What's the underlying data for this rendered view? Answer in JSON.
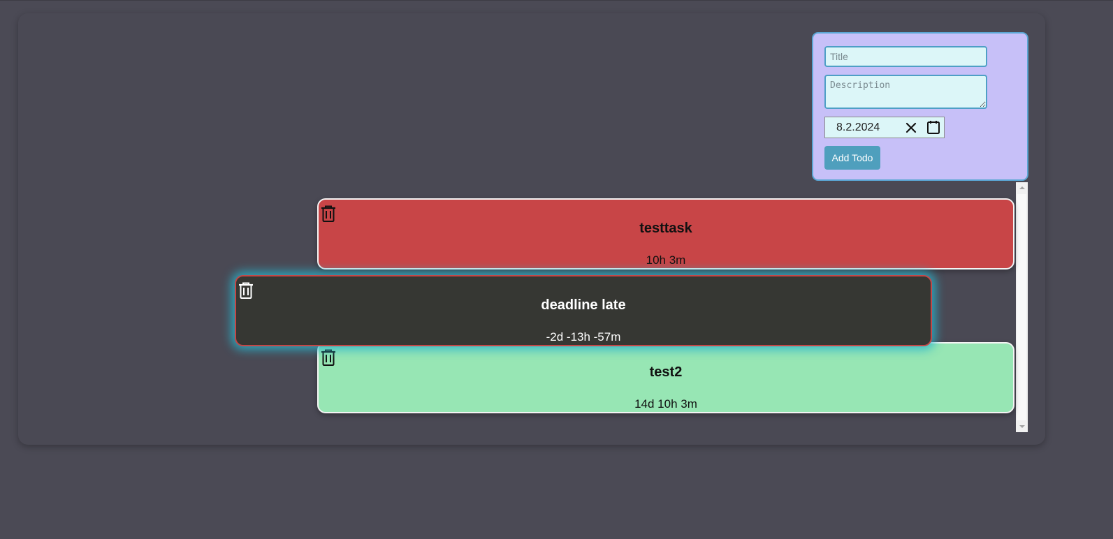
{
  "form": {
    "title_placeholder": "Title",
    "title_value": "",
    "description_placeholder": "Description",
    "description_value": "",
    "date_value": "8.2.2024",
    "add_button_label": "Add Todo",
    "clear_icon": "close-icon",
    "calendar_icon": "calendar-icon"
  },
  "todos": [
    {
      "title": "testtask",
      "time_left": "10h 3m",
      "status_color": "#c84547",
      "delete_icon": "trash-icon"
    },
    {
      "title": "deadline late",
      "time_left": "-2d -13h -57m",
      "status_color": "#363733",
      "delete_icon": "trash-icon"
    },
    {
      "title": "test2",
      "time_left": "14d 10h 3m",
      "status_color": "#97e6b4",
      "delete_icon": "trash-icon"
    }
  ],
  "colors": {
    "background": "#4b4a55",
    "form_panel": "#c7c0f8",
    "input_background": "#dcf6f8",
    "accent": "#4f9fbd",
    "late_glow": "#28b4cd"
  }
}
